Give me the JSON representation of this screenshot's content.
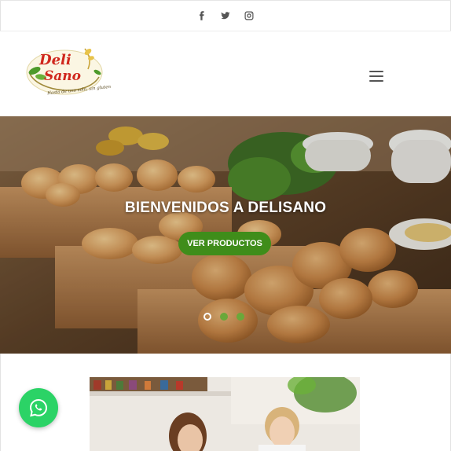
{
  "social": {
    "facebook_icon": "facebook-icon",
    "twitter_icon": "twitter-icon",
    "instagram_icon": "instagram-icon"
  },
  "header": {
    "logo_text_1": "Deli",
    "logo_text_2": "Sano",
    "logo_tagline": "Hasta de uno solo, sin gluten"
  },
  "hero": {
    "title": "BIENVENIDOS A DELISANO",
    "button_label": "VER PRODUCTOS",
    "slide_count": 3,
    "active_slide": 1
  },
  "colors": {
    "accent_green": "#3f8d1a",
    "whatsapp_green": "#2bd366",
    "logo_red": "#d0271d"
  },
  "floating": {
    "whatsapp_icon": "whatsapp-icon"
  }
}
